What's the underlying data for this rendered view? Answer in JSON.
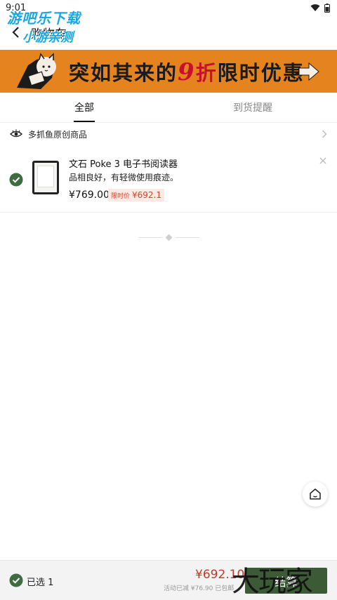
{
  "status_bar": {
    "time": "9:01"
  },
  "header": {
    "title": "购物车"
  },
  "watermark_top": {
    "line1": "游吧乐下载",
    "line2": "小游亲测"
  },
  "banner": {
    "text_before": "突如其来的",
    "nine": "9",
    "zhe": "折",
    "text_after": "限时优惠"
  },
  "tabs": [
    {
      "label": "全部"
    },
    {
      "label": "到货提醒"
    }
  ],
  "shop": {
    "name": "多抓鱼原创商品"
  },
  "product": {
    "name": "文石 Poke 3 电子书阅读器",
    "condition": "品相良好，有轻微使用痕迹。",
    "price": "¥769.00",
    "promo_label": "限时价",
    "promo_price": "¥692.1"
  },
  "bottom_bar": {
    "selected_label": "已选 1",
    "total": "¥692.10",
    "discount_note": "活动已减 ¥76.90 已包邮",
    "checkout_label": "结算"
  },
  "watermark_bottom": {
    "text": "大玩家"
  },
  "colors": {
    "accent_green": "#3d5a37",
    "banner_orange": "#e5831e",
    "price_red": "#c0392b",
    "check_green": "#3f6b40"
  }
}
